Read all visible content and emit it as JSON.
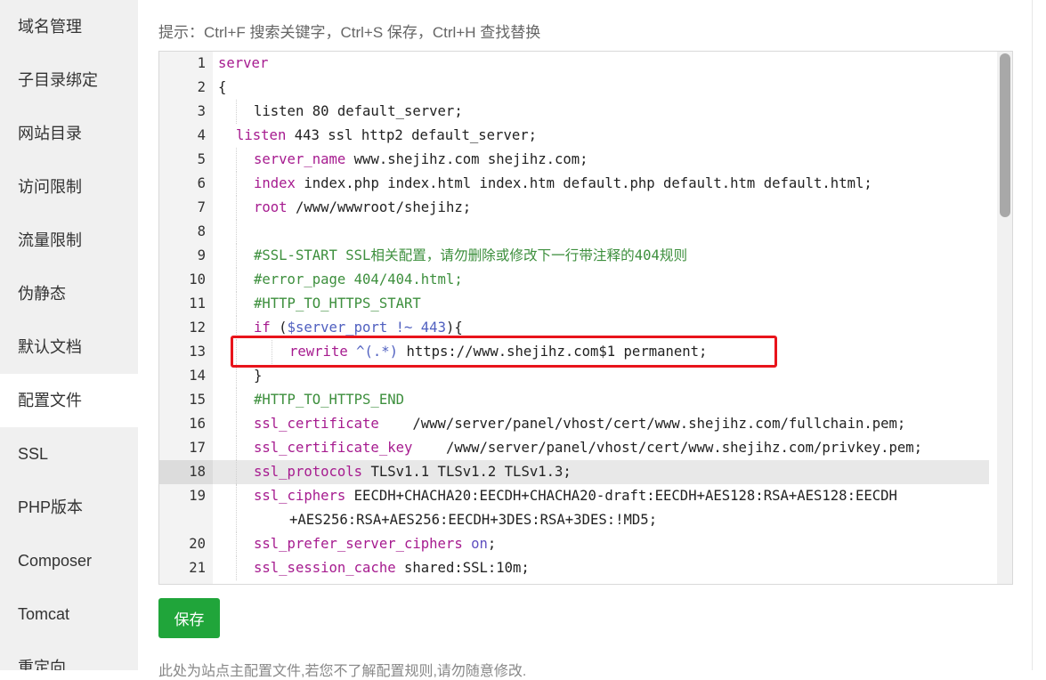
{
  "sidebar": {
    "items": [
      {
        "label": "域名管理",
        "active": false
      },
      {
        "label": "子目录绑定",
        "active": false
      },
      {
        "label": "网站目录",
        "active": false
      },
      {
        "label": "访问限制",
        "active": false
      },
      {
        "label": "流量限制",
        "active": false
      },
      {
        "label": "伪静态",
        "active": false
      },
      {
        "label": "默认文档",
        "active": false
      },
      {
        "label": "配置文件",
        "active": true
      },
      {
        "label": "SSL",
        "active": false
      },
      {
        "label": "PHP版本",
        "active": false
      },
      {
        "label": "Composer",
        "active": false
      },
      {
        "label": "Tomcat",
        "active": false
      },
      {
        "label": "重定向",
        "active": false
      }
    ]
  },
  "hint": "提示：Ctrl+F 搜索关键字，Ctrl+S 保存，Ctrl+H 查找替换",
  "editor": {
    "highlighted_line": 18,
    "boxed_line": 13,
    "lines": [
      {
        "n": "1",
        "indent": 0,
        "segs": [
          {
            "t": "server",
            "c": "kw"
          }
        ]
      },
      {
        "n": "2",
        "indent": 0,
        "segs": [
          {
            "t": "{",
            "c": "plain"
          }
        ]
      },
      {
        "n": "3",
        "indent": 1,
        "segs": [
          {
            "t": "listen 80 default_server;",
            "c": "plain"
          }
        ]
      },
      {
        "n": "4",
        "indent": 0,
        "pad": "  ",
        "segs": [
          {
            "t": "listen",
            "c": "kw"
          },
          {
            "t": " 443 ssl http2 default_server;",
            "c": "plain"
          }
        ]
      },
      {
        "n": "5",
        "indent": 1,
        "segs": [
          {
            "t": "server_name",
            "c": "kw"
          },
          {
            "t": " www.shejihz.com shejihz.com;",
            "c": "plain"
          }
        ]
      },
      {
        "n": "6",
        "indent": 1,
        "segs": [
          {
            "t": "index",
            "c": "kw"
          },
          {
            "t": " index.php index.html index.htm default.php default.htm default.html;",
            "c": "plain"
          }
        ]
      },
      {
        "n": "7",
        "indent": 1,
        "segs": [
          {
            "t": "root",
            "c": "kw"
          },
          {
            "t": " /www/wwwroot/shejihz;",
            "c": "plain"
          }
        ]
      },
      {
        "n": "8",
        "indent": 1,
        "segs": []
      },
      {
        "n": "9",
        "indent": 1,
        "segs": [
          {
            "t": "#SSL-START SSL相关配置，请勿删除或修改下一行带注释的404规则",
            "c": "cm"
          }
        ]
      },
      {
        "n": "10",
        "indent": 1,
        "segs": [
          {
            "t": "#error_page 404/404.html;",
            "c": "cm"
          }
        ]
      },
      {
        "n": "11",
        "indent": 1,
        "segs": [
          {
            "t": "#HTTP_TO_HTTPS_START",
            "c": "cm"
          }
        ]
      },
      {
        "n": "12",
        "indent": 1,
        "segs": [
          {
            "t": "if",
            "c": "kw"
          },
          {
            "t": " (",
            "c": "plain"
          },
          {
            "t": "$server_port",
            "c": "var"
          },
          {
            "t": " !~ 443",
            "c": "var"
          },
          {
            "t": "){",
            "c": "plain"
          }
        ]
      },
      {
        "n": "13",
        "indent": 2,
        "segs": [
          {
            "t": "rewrite",
            "c": "kw"
          },
          {
            "t": " ^(.*)",
            "c": "var"
          },
          {
            "t": " https://www.shejihz.com$1 permanent;",
            "c": "plain"
          }
        ]
      },
      {
        "n": "14",
        "indent": 1,
        "segs": [
          {
            "t": "}",
            "c": "plain"
          }
        ]
      },
      {
        "n": "15",
        "indent": 1,
        "segs": [
          {
            "t": "#HTTP_TO_HTTPS_END",
            "c": "cm"
          }
        ]
      },
      {
        "n": "16",
        "indent": 1,
        "segs": [
          {
            "t": "ssl_certificate",
            "c": "kw"
          },
          {
            "t": "    /www/server/panel/vhost/cert/www.shejihz.com/fullchain.pem;",
            "c": "plain"
          }
        ]
      },
      {
        "n": "17",
        "indent": 1,
        "segs": [
          {
            "t": "ssl_certificate_key",
            "c": "kw"
          },
          {
            "t": "    /www/server/panel/vhost/cert/www.shejihz.com/privkey.pem;",
            "c": "plain"
          }
        ]
      },
      {
        "n": "18",
        "indent": 1,
        "segs": [
          {
            "t": "ssl_protocols",
            "c": "kw"
          },
          {
            "t": " TLSv1.1 TLSv1.2 TLSv1.3;",
            "c": "plain"
          }
        ]
      },
      {
        "n": "19",
        "indent": 1,
        "wrap": true,
        "segs": [
          {
            "t": "ssl_ciphers",
            "c": "kw"
          },
          {
            "t": " EECDH+CHACHA20:EECDH+CHACHA20-draft:EECDH+AES128:RSA+AES128:EECDH",
            "c": "plain"
          }
        ],
        "cont": "+AES256:RSA+AES256:EECDH+3DES:RSA+3DES:!MD5;"
      },
      {
        "n": "20",
        "indent": 1,
        "segs": [
          {
            "t": "ssl_prefer_server_ciphers",
            "c": "kw"
          },
          {
            "t": " ",
            "c": "plain"
          },
          {
            "t": "on",
            "c": "on"
          },
          {
            "t": ";",
            "c": "plain"
          }
        ]
      },
      {
        "n": "21",
        "indent": 1,
        "segs": [
          {
            "t": "ssl_session_cache",
            "c": "kw"
          },
          {
            "t": " shared:SSL:10m;",
            "c": "plain"
          }
        ]
      }
    ]
  },
  "save_label": "保存",
  "note": "此处为站点主配置文件,若您不了解配置规则,请勿随意修改."
}
